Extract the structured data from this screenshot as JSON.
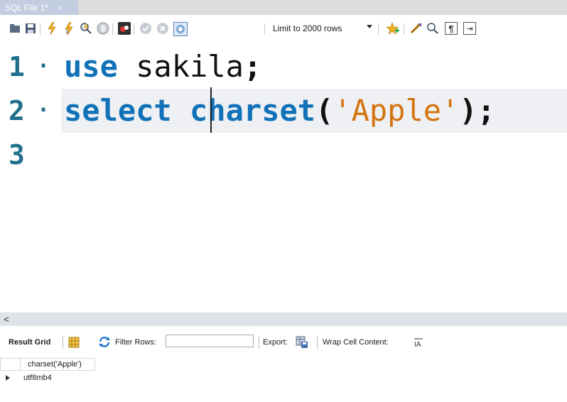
{
  "tab": {
    "title": "SQL File 1*",
    "close_glyph": "×"
  },
  "toolbar": {
    "limit_label": "Limit to 2000 rows",
    "icons": [
      "open-folder-icon",
      "save-icon",
      "execute-icon",
      "execute-selection-icon",
      "explain-icon",
      "stop-icon",
      "toggle-error-icon",
      "commit-icon",
      "rollback-icon",
      "autocommit-icon",
      "dropdown-icon",
      "bookmark-icon",
      "beautify-icon",
      "find-icon",
      "invisible-chars-icon",
      "wrap-icon"
    ]
  },
  "editor": {
    "lines": [
      {
        "number": "1",
        "marker": "·",
        "tokens": [
          {
            "text": "use",
            "class": "kw"
          },
          {
            "text": " sakila",
            "class": "id"
          },
          {
            "text": ";",
            "class": "punct"
          }
        ]
      },
      {
        "number": "2",
        "marker": "·",
        "tokens": [
          {
            "text": "select",
            "class": "kw"
          },
          {
            "text": " ",
            "class": "id"
          },
          {
            "text": "charset",
            "class": "kw"
          },
          {
            "text": "(",
            "class": "punct"
          },
          {
            "text": "'Apple'",
            "class": "str"
          },
          {
            "text": ");",
            "class": "punct"
          }
        ]
      },
      {
        "number": "3",
        "marker": "",
        "tokens": []
      }
    ]
  },
  "scroll": {
    "left_arrow": "<"
  },
  "results_toolbar": {
    "result_grid_label": "Result Grid",
    "filter_label": "Filter Rows:",
    "filter_value": "",
    "export_label": "Export:",
    "wrap_label": "Wrap Cell Content:"
  },
  "grid": {
    "columns": [
      "charset('Apple')"
    ],
    "rows": [
      [
        "utf8mb4"
      ]
    ]
  },
  "colors": {
    "keyword": "#1172b8",
    "string": "#d4740f",
    "line_number": "#1f6e8c",
    "active_line": "#eef0f3"
  }
}
